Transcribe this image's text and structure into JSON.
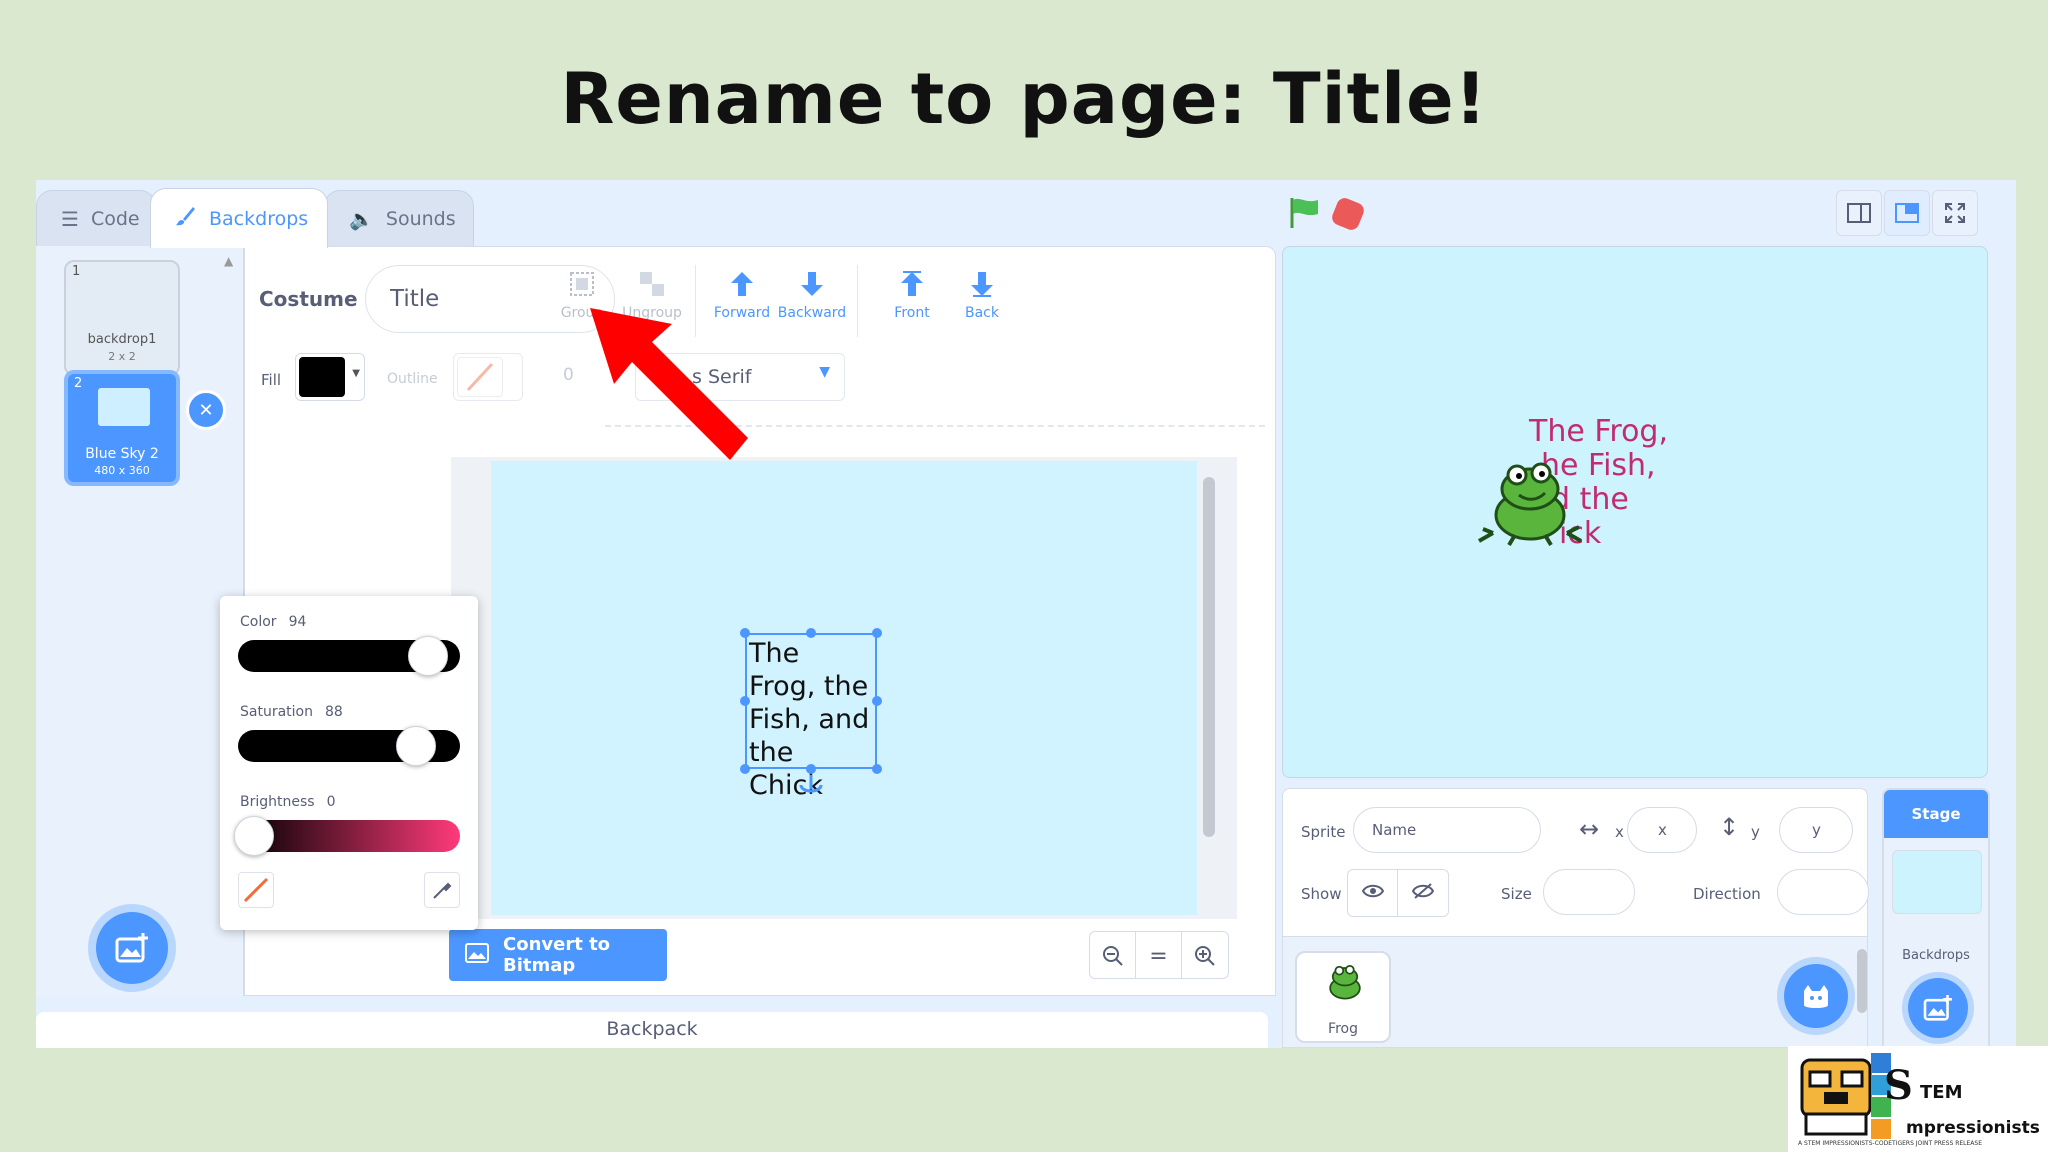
{
  "slide_title": "Rename to page: Title!",
  "tabs": {
    "code": "Code",
    "backdrops": "Backdrops",
    "sounds": "Sounds"
  },
  "backdrops": [
    {
      "num": "1",
      "name": "backdrop1",
      "size": "2 x 2"
    },
    {
      "num": "2",
      "name": "Blue Sky 2",
      "size": "480 x 360"
    }
  ],
  "paint": {
    "costume_label": "Costume",
    "costume_name": "Title",
    "tools": {
      "group": "Group",
      "ungroup": "Ungroup",
      "forward": "Forward",
      "backward": "Backward",
      "front": "Front",
      "back": "Back"
    },
    "fill_label": "Fill",
    "fill_color": "#000000",
    "outline_label": "Outline",
    "outline_width": "0",
    "font": "s Serif",
    "canvas_text": "The Frog, the Fish, and the Chick",
    "convert_button": "Convert to Bitmap",
    "zoom_reset": "="
  },
  "color_picker": {
    "color_label": "Color",
    "color_value": "94",
    "saturation_label": "Saturation",
    "saturation_value": "88",
    "brightness_label": "Brightness",
    "brightness_value": "0"
  },
  "backpack": "Backpack",
  "stage": {
    "text_lines": [
      "The Frog,",
      "he Fish,",
      "d the",
      "ick"
    ]
  },
  "sprite_info": {
    "sprite_label": "Sprite",
    "name_placeholder": "Name",
    "x_label": "x",
    "x_placeholder": "x",
    "y_label": "y",
    "y_placeholder": "y",
    "show_label": "Show",
    "size_label": "Size",
    "direction_label": "Direction"
  },
  "sprites": [
    {
      "name": "Frog"
    }
  ],
  "stage_pane": {
    "header": "Stage",
    "backdrops_label": "Backdrops"
  },
  "logo": {
    "letters": "S",
    "word1": "TEM",
    "word2": "mpressionists",
    "fine": "A STEM IMPRESSIONISTS-CODETIGERS JOINT PRESS RELEASE"
  },
  "colors": {
    "accent": "#4c97ff",
    "stop": "#ec5959",
    "arrow": "#ff0000",
    "stage_text": "#c12c6f"
  }
}
